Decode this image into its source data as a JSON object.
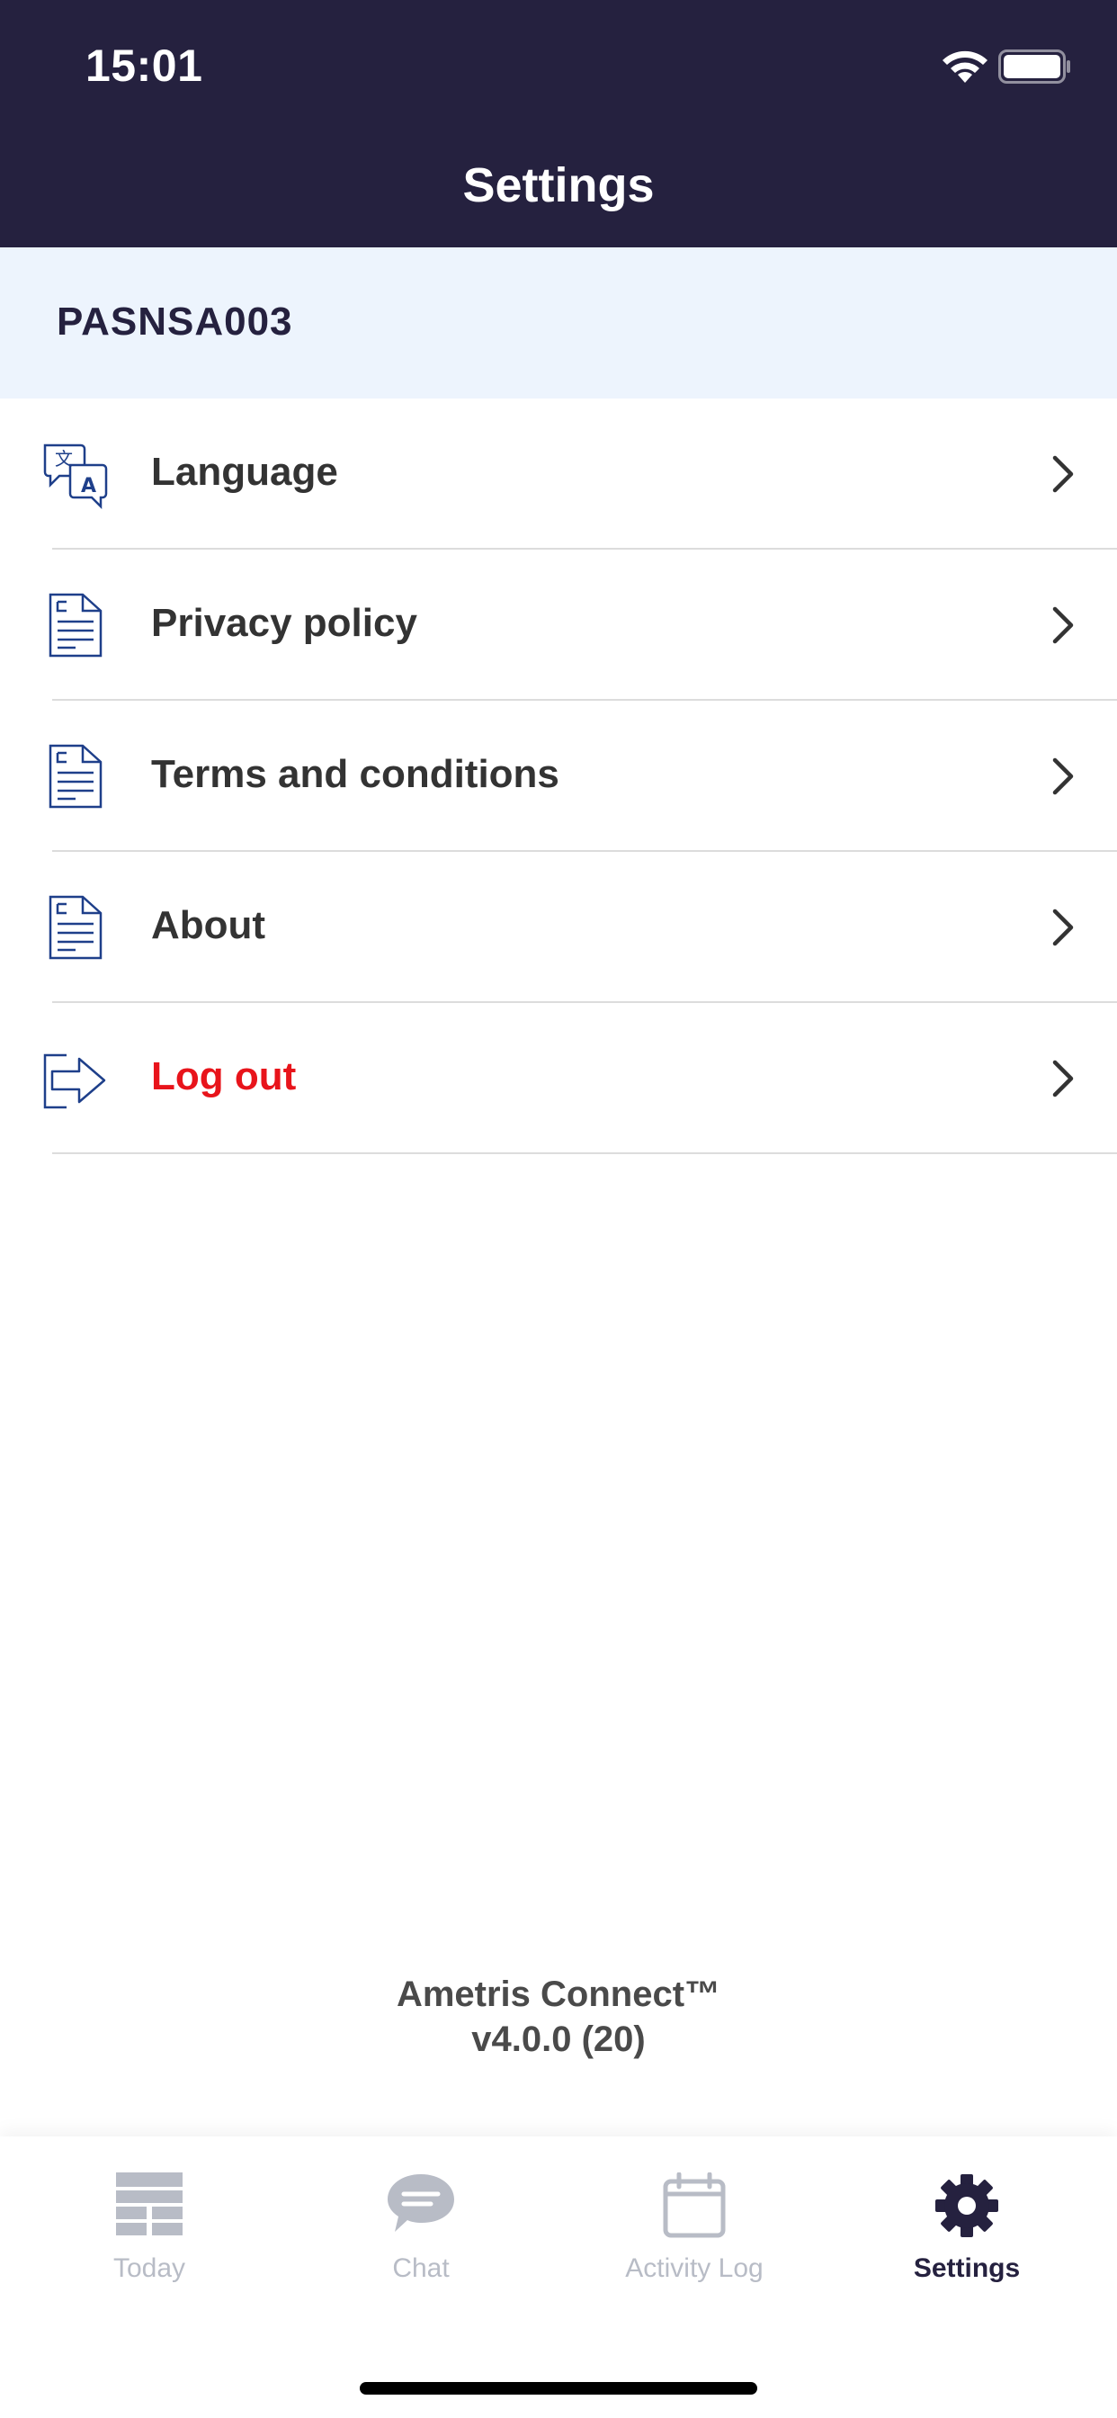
{
  "status_bar": {
    "time": "15:01"
  },
  "header": {
    "title": "Settings"
  },
  "account": {
    "id": "PASNSA003"
  },
  "menu": {
    "items": [
      {
        "label": "Language",
        "icon": "language-icon"
      },
      {
        "label": "Privacy policy",
        "icon": "document-icon"
      },
      {
        "label": "Terms and conditions",
        "icon": "document-icon"
      },
      {
        "label": "About",
        "icon": "document-icon"
      },
      {
        "label": "Log out",
        "icon": "logout-icon"
      }
    ]
  },
  "footer": {
    "app_name": "Ametris Connect™",
    "version": "v4.0.0 (20)"
  },
  "tabbar": {
    "tabs": [
      {
        "label": "Today",
        "icon": "today-icon"
      },
      {
        "label": "Chat",
        "icon": "chat-icon"
      },
      {
        "label": "Activity Log",
        "icon": "calendar-icon"
      },
      {
        "label": "Settings",
        "icon": "gear-icon",
        "active": true
      }
    ]
  },
  "colors": {
    "header_bg": "#25213f",
    "account_bg": "#edf4fd",
    "icon_blue": "#1e3f8a",
    "danger": "#e8141b",
    "tab_inactive": "#b8bcc6"
  }
}
